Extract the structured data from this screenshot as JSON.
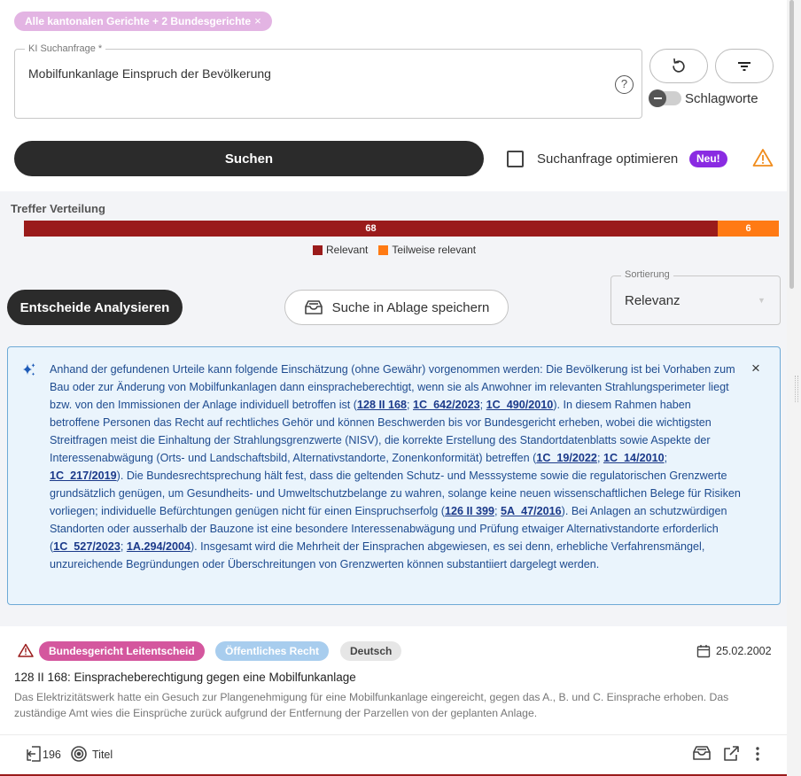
{
  "filter_chip": {
    "label": "Alle kantonalen Gerichte + 2 Bundesgerichte",
    "remove_icon": "close-icon"
  },
  "query": {
    "label": "KI Suchanfrage *",
    "value": "Mobilfunkanlage Einspruch der Bevölkerung",
    "help_icon": "?"
  },
  "toolbar": {
    "reset_icon": "refresh-icon",
    "filter_icon": "filter-icon",
    "keywords_label": "Schlagworte",
    "keywords_toggle_on": false
  },
  "search": {
    "button_label": "Suchen",
    "optimize_label": "Suchanfrage optimieren",
    "optimize_checked": false,
    "new_badge": "Neu!"
  },
  "distribution": {
    "title": "Treffer Verteilung",
    "relevant_count": "68",
    "partial_count": "6",
    "legend_relevant": "Relevant",
    "legend_partial": "Teilweise relevant",
    "colors": {
      "relevant": "#9a1b1b",
      "partial": "#ff7a14"
    }
  },
  "actions": {
    "analyse_label": "Entscheide Analysieren",
    "save_label": "Suche in Ablage speichern"
  },
  "sort": {
    "label": "Sortierung",
    "value": "Relevanz"
  },
  "ai_summary": {
    "s1": "Anhand der gefundenen Urteile kann folgende Einschätzung (ohne Gewähr) vorgenommen werden: Die Bevölkerung ist bei Vorhaben zum Bau oder zur Änderung von Mobilfunkanlagen dann einspracheberechtigt, wenn sie als Anwohner im relevanten Strahlungsperimeter liegt bzw. von den Immissionen der Anlage individuell betroffen ist (",
    "r1": "128 II 168",
    "sep": "; ",
    "r2": "1C_642/2023",
    "r3": "1C_490/2010",
    "s2": "). In diesem Rahmen haben betroffene Personen das Recht auf rechtliches Gehör und können Beschwerden bis vor Bundesgericht erheben, wobei die wichtigsten Streitfragen meist die Einhaltung der Strahlungsgrenzwerte (NISV), die korrekte Erstellung des Standortdatenblatts sowie Aspekte der Interessenabwägung (Orts- und Landschaftsbild, Alternativstandorte, Zonenkonformität) betreffen (",
    "r4": "1C_19/2022",
    "r5": "1C_14/2010",
    "r6": "1C_217/2019",
    "s3": "). Die Bundesrechtsprechung hält fest, dass die geltenden Schutz- und Messsysteme sowie die regulatorischen Grenzwerte grundsätzlich genügen, um Gesundheits- und Umweltschutzbelange zu wahren, solange keine neuen wissenschaftlichen Belege für Risiken vorliegen; individuelle Befürchtungen genügen nicht für einen Einspruchserfolg (",
    "r7": "126 II 399",
    "r8": "5A_47/2016",
    "s4": "). Bei Anlagen an schutzwürdigen Standorten oder ausserhalb der Bauzone ist eine besondere Interessenabwägung und Prüfung etwaiger Alternativstandorte erforderlich (",
    "r9": "1C_527/2023",
    "r10": "1A.294/2004",
    "s5": "). Insgesamt wird die Mehrheit der Einsprachen abgewiesen, es sei denn, erhebliche Verfahrensmängel, unzureichende Begründungen oder Überschreitungen von Grenzwerten können substantiiert dargelegt werden."
  },
  "result": {
    "badges": [
      "Bundesgericht Leitentscheid",
      "Öffentliches Recht",
      "Deutsch"
    ],
    "date": "25.02.2002",
    "title": "128 II 168: Einspracheberechtigung gegen eine Mobilfunkanlage",
    "summary": "Das Elektrizitätswerk hatte ein Gesuch zur Plangenehmigung für eine Mobilfunkanlage eingereicht, gegen das A., B. und C. Einsprache erhoben. Das zuständige Amt wies die Einsprüche zurück aufgrund der Entfernung der Parzellen von der geplanten Anlage.",
    "citation_count": "196",
    "match_type": "Titel"
  }
}
